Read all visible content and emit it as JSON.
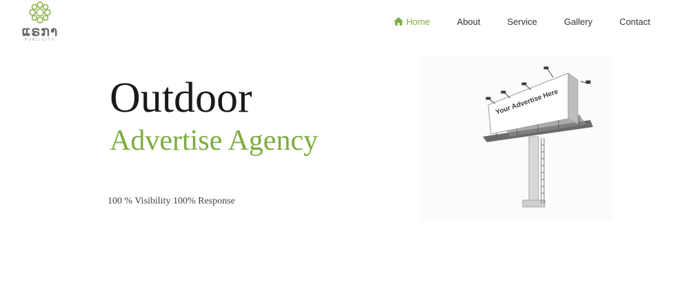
{
  "brand": {
    "logo_word": "ແຣກາ",
    "logo_subtitle": "PUBLICITY",
    "accent_color": "#7cad3f"
  },
  "nav": {
    "items": [
      {
        "label": "Home",
        "icon": "home-icon",
        "active": true
      },
      {
        "label": "About"
      },
      {
        "label": "Service"
      },
      {
        "label": "Gallery"
      },
      {
        "label": "Contact"
      }
    ]
  },
  "hero": {
    "title": "Outdoor",
    "subtitle": "Advertise Agency",
    "tagline": "100 % Visibility 100% Response",
    "billboard_text": "Your Advertise Here"
  }
}
